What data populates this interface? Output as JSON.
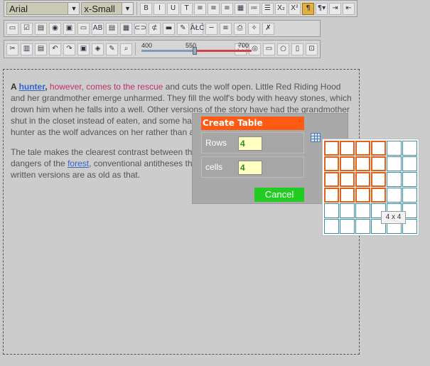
{
  "toolbar1": {
    "font_family": "Arial",
    "font_size": "x-Small",
    "buttons": [
      {
        "name": "bold-button",
        "glyph": "B"
      },
      {
        "name": "italic-button",
        "glyph": "I"
      },
      {
        "name": "underline-button",
        "glyph": "U"
      },
      {
        "name": "strikethrough-button",
        "glyph": "T"
      },
      {
        "name": "align-left-button",
        "glyph": "≡"
      },
      {
        "name": "align-center-button",
        "glyph": "≡"
      },
      {
        "name": "align-right-button",
        "glyph": "≡"
      },
      {
        "name": "justify-button",
        "glyph": "▦"
      },
      {
        "name": "ordered-list-button",
        "glyph": "≔"
      },
      {
        "name": "unordered-list-button",
        "glyph": "☰"
      },
      {
        "name": "subscript-button",
        "glyph": "X₂"
      },
      {
        "name": "superscript-button",
        "glyph": "X²"
      },
      {
        "name": "paragraph-button",
        "glyph": "¶"
      },
      {
        "name": "paragraph-menu-button",
        "glyph": "¶▾"
      },
      {
        "name": "indent-button",
        "glyph": "⇥"
      },
      {
        "name": "outdent-button",
        "glyph": "⇤"
      }
    ]
  },
  "toolbar2": {
    "buttons": [
      {
        "name": "textbox-button",
        "glyph": "▭"
      },
      {
        "name": "checkbox-button",
        "glyph": "☑"
      },
      {
        "name": "form-button",
        "glyph": "▤"
      },
      {
        "name": "radio-button",
        "glyph": "◉"
      },
      {
        "name": "image-field-button",
        "glyph": "▣"
      },
      {
        "name": "input-button",
        "glyph": "▭"
      },
      {
        "name": "label-button",
        "glyph": "AB"
      },
      {
        "name": "textarea-button",
        "glyph": "▤"
      },
      {
        "name": "table-button",
        "glyph": "▦"
      },
      {
        "name": "chain-button",
        "glyph": "⊂⊃"
      },
      {
        "name": "unlink-button",
        "glyph": "⊄"
      },
      {
        "name": "insert-image-button",
        "glyph": "▬"
      },
      {
        "name": "document-button",
        "glyph": "✎"
      },
      {
        "name": "spellcheck-button",
        "glyph": "ÀŁĆ"
      },
      {
        "name": "horizontal-rule-button",
        "glyph": "─"
      },
      {
        "name": "page-break-button",
        "glyph": "≡"
      },
      {
        "name": "print-button",
        "glyph": "⎙"
      },
      {
        "name": "clean-button",
        "glyph": "✧"
      },
      {
        "name": "remove-format-button",
        "glyph": "✗"
      }
    ]
  },
  "toolbar3": {
    "buttons": [
      {
        "name": "cut-button",
        "glyph": "✂"
      },
      {
        "name": "paste-button",
        "glyph": "▥"
      },
      {
        "name": "paste-text-button",
        "glyph": "▤"
      },
      {
        "name": "undo-button",
        "glyph": "↶"
      },
      {
        "name": "redo-button",
        "glyph": "↷"
      },
      {
        "name": "save-button",
        "glyph": "▣"
      },
      {
        "name": "html-button",
        "glyph": "◈"
      },
      {
        "name": "edit-button",
        "glyph": "✎"
      },
      {
        "name": "preview-button",
        "glyph": "⌕"
      }
    ],
    "slider": {
      "min_label": "400",
      "mid_label": "550",
      "max_label": "700",
      "value": 550
    },
    "extra_buttons": [
      {
        "name": "fullscreen-button",
        "glyph": "⛶"
      },
      {
        "name": "target-button",
        "glyph": "◎"
      },
      {
        "name": "design-mode-button",
        "glyph": "▭"
      },
      {
        "name": "circle-button",
        "glyph": "○"
      },
      {
        "name": "code-mode-button",
        "glyph": "▯"
      },
      {
        "name": "preview-mode-button",
        "glyph": "⊡"
      }
    ]
  },
  "editor": {
    "p1": {
      "a_prefix": "A ",
      "link_hunter": "hunter",
      "comma": ",",
      "pink": " however, comes to the rescue",
      "rest": " and cuts the wolf open. Little Red Riding Hood and her grandmother emerge unharmed. They fill the wolf's body with heavy stones, which drown him when he falls into a well. Other versions of the story have had the grandmother shut in the closet instead of eaten, and some have Little Red Riding Hood saved by the hunter as the wolf advances on her rather than after she is eaten."
    },
    "p2": {
      "pre": "The tale makes the clearest contrast between the safe world of the village and the dangers of the ",
      "link_forest": "forest",
      "post": ", conventional antitheses that are essentially medieval, though no written versions are as old as that."
    }
  },
  "dialog": {
    "title": "Create Table",
    "rows_label": "Rows",
    "rows_value": "4",
    "cells_label": "cells",
    "cells_value": "4",
    "cancel_label": "Cancel"
  },
  "table_picker": {
    "rows": 6,
    "cols": 6,
    "selected_rows": 4,
    "selected_cols": 4,
    "tooltip": "4 x 4"
  },
  "colors": {
    "accent_orange": "#ff5a14",
    "cancel_green": "#22cc22",
    "link_blue": "#3366cc",
    "pink_text": "#c03070"
  }
}
